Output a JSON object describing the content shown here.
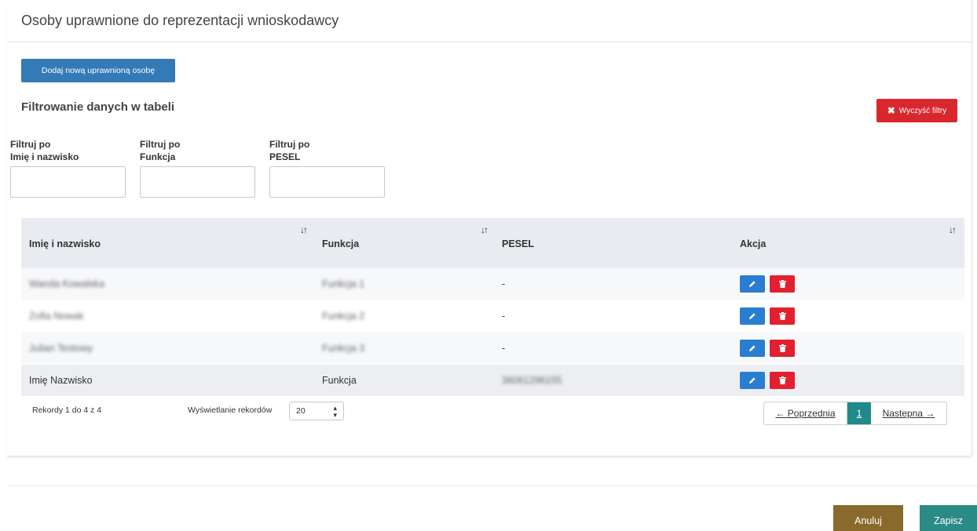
{
  "panel": {
    "title": "Osoby uprawnione do reprezentacji wnioskodawcy"
  },
  "add_button": {
    "label": "Dodaj nową uprawnioną osobę"
  },
  "filters": {
    "title": "Filtrowanie danych w tabeli",
    "clear_label": "Wyczyść filtry",
    "fields": [
      {
        "label_line1": "Filtruj po",
        "label_line2": "Imię i nazwisko",
        "value": ""
      },
      {
        "label_line1": "Filtruj po",
        "label_line2": "Funkcja",
        "value": ""
      },
      {
        "label_line1": "Filtruj po",
        "label_line2": "PESEL",
        "value": ""
      }
    ]
  },
  "table": {
    "columns": [
      "Imię i nazwisko",
      "Funkcja",
      "PESEL",
      "Akcja"
    ],
    "sort_icon": "sort-arrows-icon",
    "rows": [
      {
        "name": "Wanda Kowalska",
        "function": "Funkcja 1",
        "pesel": "-"
      },
      {
        "name": "Zofia Nowak",
        "function": "Funkcja 2",
        "pesel": "-"
      },
      {
        "name": "Julian Testowy",
        "function": "Funkcja 3",
        "pesel": "-"
      },
      {
        "name": "Imię Nazwisko",
        "function": "Funkcja",
        "pesel": "36061296155"
      }
    ]
  },
  "footer": {
    "records": "Rekordy 1 do 4 z 4",
    "length_label": "Wyświetlanie rekordów",
    "length_value": "20",
    "prev": "← Poprzednia",
    "current_page": "1",
    "next": "Nastepna →"
  },
  "actions": {
    "cancel": "Anuluj",
    "save": "Zapisz"
  },
  "colors": {
    "primary": "#337ab7",
    "danger": "#d9272e",
    "edit": "#2a7ed1",
    "delete": "#e3202f",
    "page_active": "#1f8a8a",
    "cancel": "#8a6a2c",
    "save": "#2a8a86"
  }
}
